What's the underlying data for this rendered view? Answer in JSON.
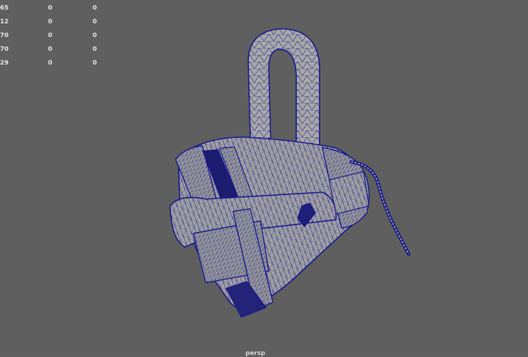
{
  "hud": {
    "rows": [
      {
        "a": "65",
        "b": "0",
        "c": "0"
      },
      {
        "a": "12",
        "b": "0",
        "c": "0"
      },
      {
        "a": "70",
        "b": "0",
        "c": "0"
      },
      {
        "a": "70",
        "b": "0",
        "c": "0"
      },
      {
        "a": "29",
        "b": "0",
        "c": "0"
      }
    ]
  },
  "camera_label": "persp",
  "colors": {
    "background": "#5f5f5f",
    "mesh_fill": "#9e9e9e",
    "wire": "#14148c",
    "hud_text": "#e6e6e6"
  }
}
